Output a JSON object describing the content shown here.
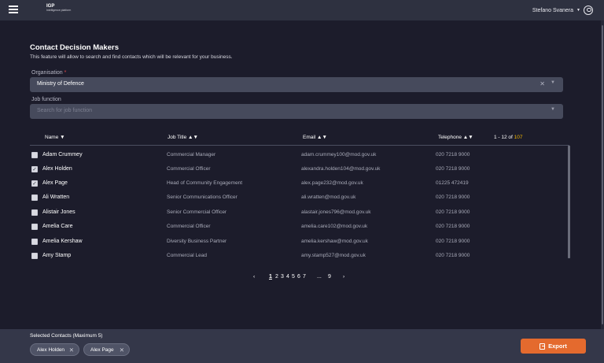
{
  "header": {
    "logo_mark": "IGP",
    "logo_text": "Intelligence platform",
    "user_name": "Stefano Svanera",
    "caret_icon": "caret-down-icon",
    "avatar_icon": "user-circle-icon"
  },
  "page": {
    "title": "Contact Decision Makers",
    "description": "This feature will allow to search and find contacts which will be relevant for your business."
  },
  "organisation": {
    "label": "Organisation",
    "required_mark": "*",
    "value": "Ministry of Defence"
  },
  "job_function": {
    "label": "Job function",
    "placeholder": "Search for job function"
  },
  "table": {
    "columns": {
      "name": "Name ▼",
      "job_title": "Job Title ▲▼",
      "email": "Email ▲▼",
      "telephone": "Telephone ▲▼"
    },
    "range": "1 - 12 of",
    "total": "107",
    "rows": [
      {
        "checked": "",
        "name": "Adam Crummey",
        "job": "Commercial Manager",
        "email": "adam.crummey100@mod.gov.uk",
        "tel": "020 7218 9000"
      },
      {
        "checked": "✓",
        "name": "Alex Holden",
        "job": "Commercial Officer",
        "email": "alexandra.holden104@mod.gov.uk",
        "tel": "020 7218 9000"
      },
      {
        "checked": "✓",
        "name": "Alex Page",
        "job": "Head of Community Engagement",
        "email": "alex.page232@mod.gov.uk",
        "tel": "01225 472419"
      },
      {
        "checked": "",
        "name": "Ali Wratten",
        "job": "Senior Communications Officer",
        "email": "ali.wratten@mod.gov.uk",
        "tel": "020 7218 9000"
      },
      {
        "checked": "",
        "name": "Alistair Jones",
        "job": "Senior Commercial Officer",
        "email": "alastair.jones796@mod.gov.uk",
        "tel": "020 7218 9000"
      },
      {
        "checked": "",
        "name": "Amelia Care",
        "job": "Commercial Officer",
        "email": "amelia.care102@mod.gov.uk",
        "tel": "020 7218 9000"
      },
      {
        "checked": "",
        "name": "Amelia Kershaw",
        "job": "Diversity Business Partner",
        "email": "amelia.kershaw@mod.gov.uk",
        "tel": "020 7218 9000"
      },
      {
        "checked": "",
        "name": "Amy Stamp",
        "job": "Commercial Lead",
        "email": "amy.stamp527@mod.gov.uk",
        "tel": "020 7218 9000"
      }
    ]
  },
  "pagination": {
    "prev": "‹",
    "pages": [
      "1",
      "2",
      "3",
      "4",
      "5",
      "6",
      "7"
    ],
    "ellipsis": "...",
    "last": "9",
    "next": "›",
    "current": 1
  },
  "footer": {
    "selected_label": "Selected Contacts (Maximum 5)",
    "chips": [
      "Alex Holden",
      "Alex Page"
    ],
    "export_label": "Export"
  },
  "colors": {
    "background": "#1c1c2b",
    "accent": "#e46a2e",
    "total_highlight": "#f0b400"
  }
}
